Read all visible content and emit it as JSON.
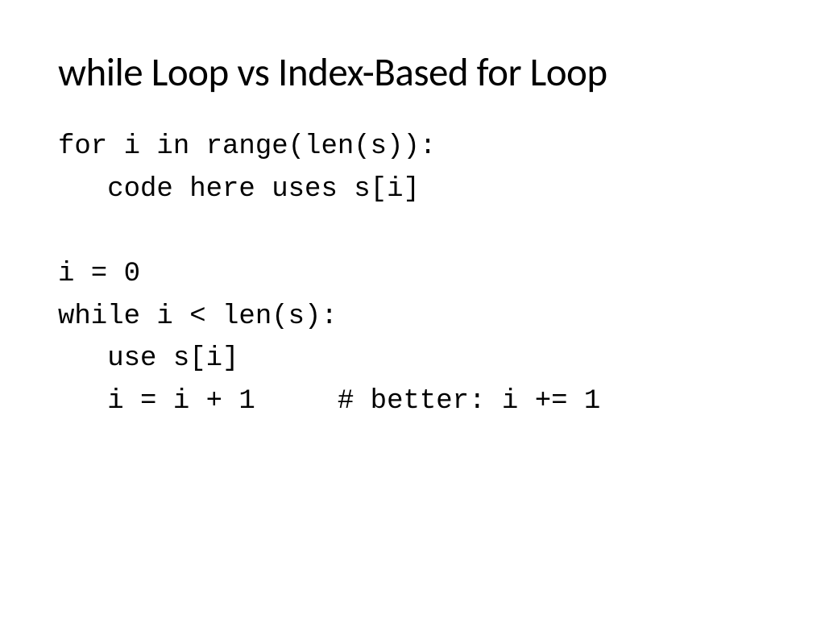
{
  "slide": {
    "title": "while Loop vs Index-Based for Loop",
    "code": {
      "line1": "for i in range(len(s)):",
      "line2": "   code here uses s[i]",
      "line3": "",
      "line4": "i = 0",
      "line5": "while i < len(s):",
      "line6": "   use s[i]",
      "line7": "   i = i + 1     # better: i += 1"
    }
  }
}
